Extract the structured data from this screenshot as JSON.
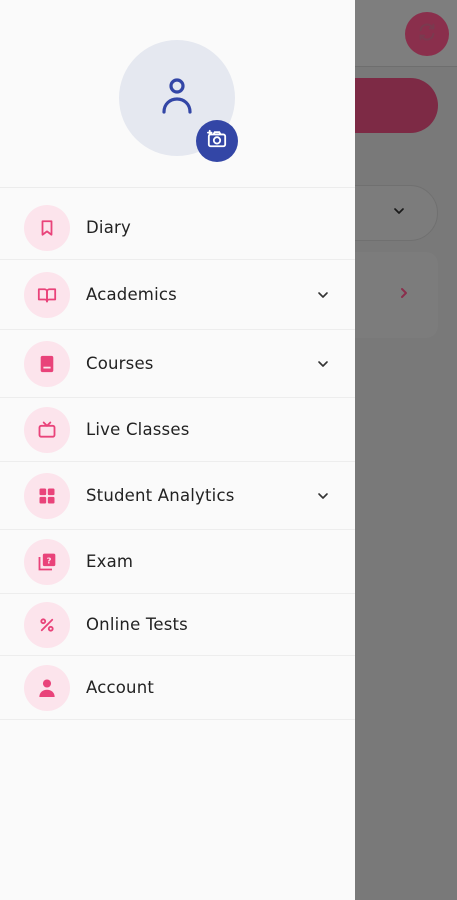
{
  "colors": {
    "accent_pink": "#e9437a",
    "icon_bg_pink": "#fce4ec",
    "avatar_bg": "#e5e8f0",
    "brand_blue": "#3346a6",
    "overlay_gray": "#797979"
  },
  "profile": {
    "avatar_icon": "user-icon",
    "camera_icon": "camera-icon"
  },
  "menu": {
    "items": [
      {
        "label": "Diary",
        "icon": "bookmark-icon",
        "expandable": false
      },
      {
        "label": "Academics",
        "icon": "open-book-icon",
        "expandable": true
      },
      {
        "label": "Courses",
        "icon": "book-icon",
        "expandable": true
      },
      {
        "label": "Live Classes",
        "icon": "tv-icon",
        "expandable": false
      },
      {
        "label": "Student Analytics",
        "icon": "grid-icon",
        "expandable": true
      },
      {
        "label": "Exam",
        "icon": "quiz-icon",
        "expandable": false
      },
      {
        "label": "Online Tests",
        "icon": "percent-icon",
        "expandable": false
      },
      {
        "label": "Account",
        "icon": "person-icon",
        "expandable": false
      }
    ]
  },
  "background": {
    "sync_icon": "sync-icon",
    "select_icon": "chevron-down-icon",
    "card_icon": "chevron-right-icon"
  }
}
